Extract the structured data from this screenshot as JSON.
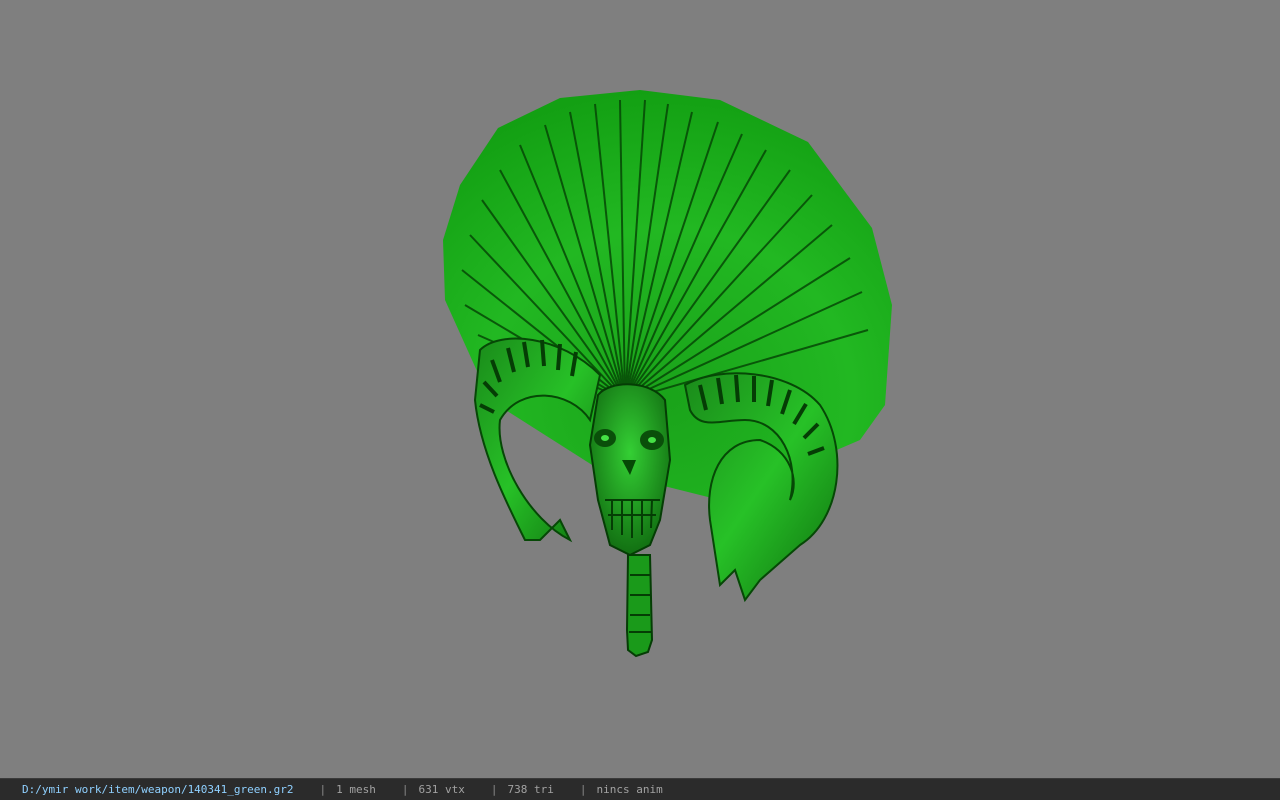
{
  "viewport": {
    "background": "#7f7f7f",
    "model": {
      "description_icon": "green-skull-fan-weapon-model",
      "base_color": "#1fbf1f"
    }
  },
  "status_bar": {
    "file_path": "D:/ymir work/item/weapon/140341_green.gr2",
    "separator": "|",
    "mesh_count": "1 mesh",
    "vertex_count": "631 vtx",
    "triangle_count": "738 tri",
    "anim_status": "nincs anim"
  }
}
